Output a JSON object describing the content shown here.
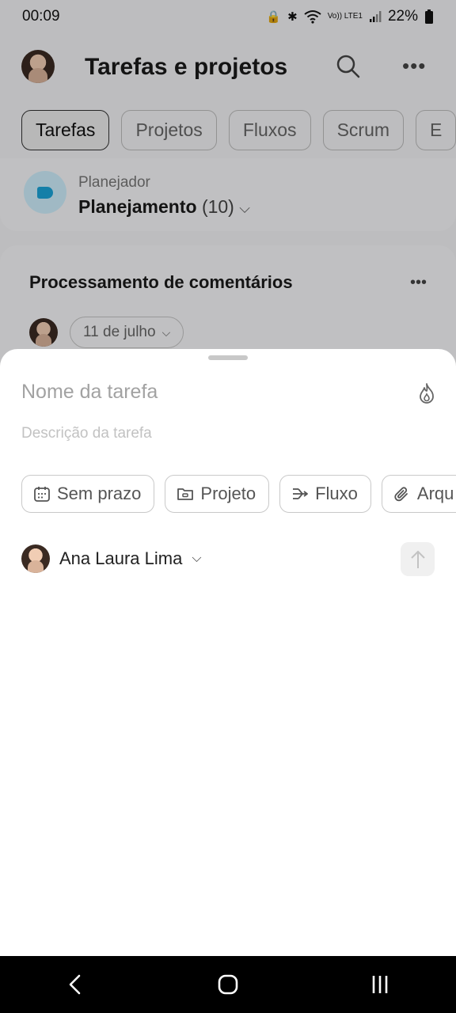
{
  "status_bar": {
    "time": "00:09",
    "battery": "22%",
    "network": "Vo)) LTE1"
  },
  "header": {
    "title": "Tarefas e projetos"
  },
  "tabs": [
    {
      "label": "Tarefas",
      "active": true
    },
    {
      "label": "Projetos"
    },
    {
      "label": "Fluxos"
    },
    {
      "label": "Scrum"
    },
    {
      "label": "E"
    }
  ],
  "planner": {
    "label": "Planejador",
    "name": "Planejamento",
    "count": "(10)"
  },
  "task_card": {
    "title": "Processamento de comentários",
    "date": "11 de julho"
  },
  "sheet": {
    "name_placeholder": "Nome da tarefa",
    "description_placeholder": "Descrição da tarefa",
    "chips": [
      {
        "label": "Sem prazo",
        "icon": "calendar-icon"
      },
      {
        "label": "Projeto",
        "icon": "folder-icon"
      },
      {
        "label": "Fluxo",
        "icon": "flow-icon"
      },
      {
        "label": "Arqu",
        "icon": "paperclip-icon"
      }
    ],
    "assignee": "Ana Laura Lima"
  }
}
